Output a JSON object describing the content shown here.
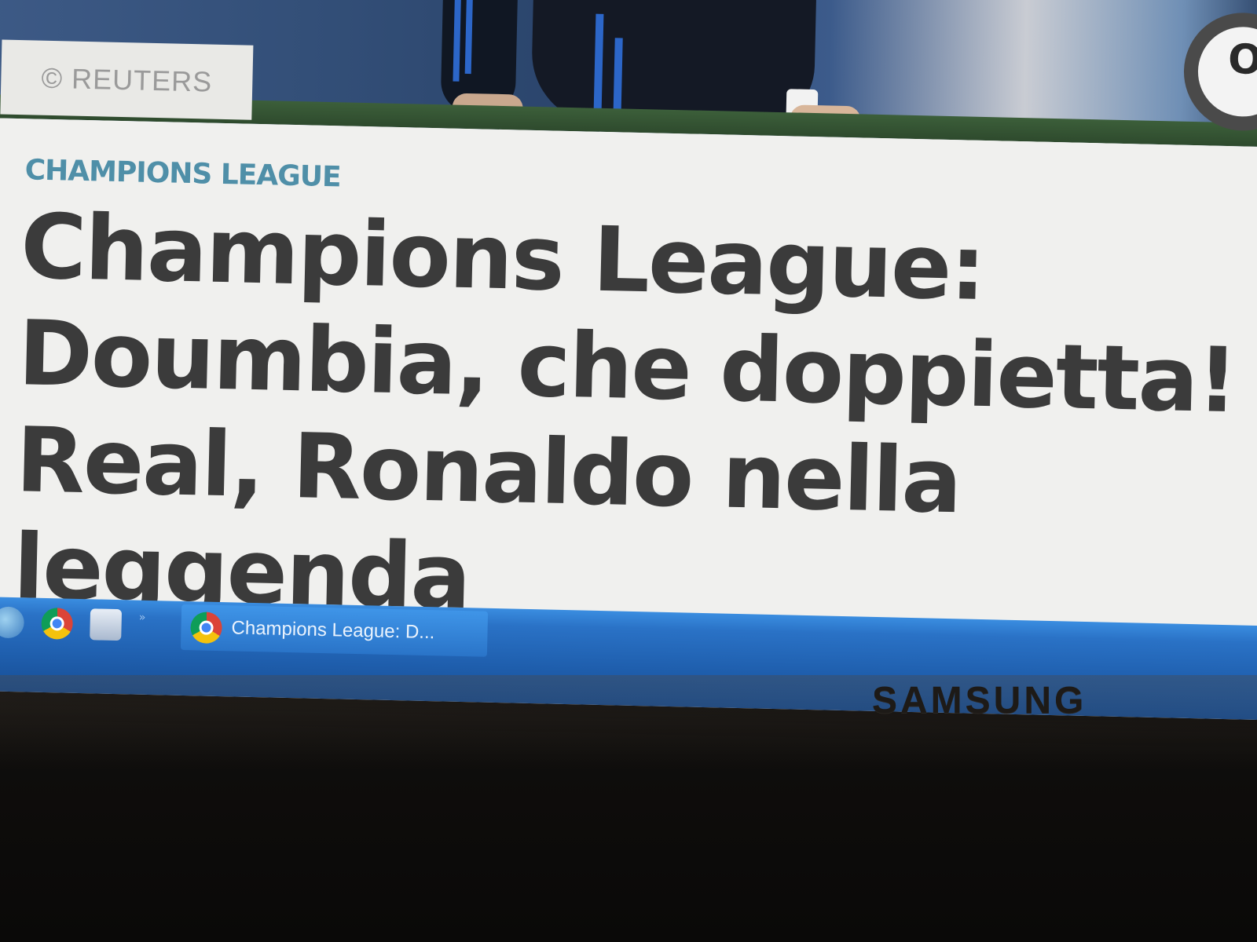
{
  "hero": {
    "credit": "© REUTERS",
    "badge_letter": "O"
  },
  "article": {
    "category": "CHAMPIONS LEAGUE",
    "headline": "Champions League: Doumbia, che doppietta! Real, Ronaldo nella leggenda"
  },
  "taskbar": {
    "quick_launch": [
      "show-desktop-icon",
      "chrome-icon",
      "windows-explorer-icon"
    ],
    "window_button_label": "Champions League: D..."
  },
  "monitor": {
    "brand": "SAMSUNG"
  },
  "colors": {
    "category": "#4f8fa8",
    "headline": "#3b3b3b",
    "taskbar": "#1f5fae",
    "page_background": "#f0f0ee"
  }
}
